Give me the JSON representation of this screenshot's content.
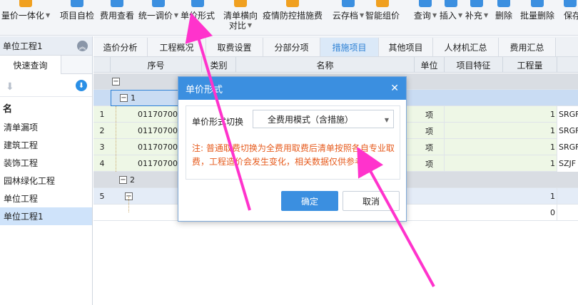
{
  "toolbar": {
    "items": [
      {
        "label": "量价一体化",
        "caret": true,
        "icon_color": "#f0a020"
      },
      {
        "label": "项目自检",
        "caret": false,
        "icon_color": "#3b8fe0"
      },
      {
        "label": "费用查看",
        "caret": false,
        "icon_color": "#3b8fe0"
      },
      {
        "label": "统一调价",
        "caret": true,
        "icon_color": "#3b8fe0"
      },
      {
        "label": "单价形式",
        "caret": false,
        "icon_color": "#3b8fe0"
      },
      {
        "label": "清单横向",
        "label2": "对比",
        "caret": true,
        "icon_color": "#f0a020"
      },
      {
        "label": "疫情防控措施费",
        "caret": false,
        "icon_color": "#f0a020"
      },
      {
        "label": "云存档",
        "caret": true,
        "icon_color": "#3b8fe0"
      },
      {
        "label": "智能组价",
        "caret": false,
        "icon_color": "#f0a020"
      },
      {
        "label": "查询",
        "caret": true,
        "icon_color": "#3b8fe0"
      },
      {
        "label": "插入",
        "caret": true,
        "icon_color": "#3b8fe0"
      },
      {
        "label": "补充",
        "caret": true,
        "icon_color": "#3b8fe0"
      },
      {
        "label": "删除",
        "caret": false,
        "icon_color": "#3b8fe0"
      },
      {
        "label": "批量删除",
        "caret": false,
        "icon_color": "#3b8fe0"
      },
      {
        "label": "保存",
        "caret": false,
        "icon_color": "#3b8fe0"
      }
    ]
  },
  "left_panel": {
    "title": "单位工程1",
    "collapse_icon": "double-chevron-up-icon",
    "tab": "快速查询",
    "section_label": "名",
    "items": [
      {
        "label": "清单漏项",
        "active": false
      },
      {
        "label": "建筑工程",
        "active": false
      },
      {
        "label": "装饰工程",
        "active": false
      },
      {
        "label": "园林绿化工程",
        "active": false
      },
      {
        "label": "单位工程",
        "active": false
      },
      {
        "label": "单位工程1",
        "active": true
      }
    ]
  },
  "tabs": [
    {
      "label": "造价分析",
      "active": false
    },
    {
      "label": "工程概况",
      "active": false
    },
    {
      "label": "取费设置",
      "active": false
    },
    {
      "label": "分部分项",
      "active": false
    },
    {
      "label": "措施项目",
      "active": true
    },
    {
      "label": "其他项目",
      "active": false
    },
    {
      "label": "人材机汇总",
      "active": false
    },
    {
      "label": "费用汇总",
      "active": false
    }
  ],
  "grid": {
    "columns": [
      "序号",
      "类别",
      "名称",
      "单位",
      "项目特征",
      "工程量"
    ],
    "rows": [
      {
        "num": "",
        "code": "",
        "type": "group0",
        "unit": "",
        "qty": "",
        "extra": ""
      },
      {
        "num": "",
        "code": "1",
        "type": "group1",
        "unit": "",
        "qty": "",
        "extra": ""
      },
      {
        "num": "1",
        "code": "01170700",
        "type": "item",
        "unit": "项",
        "qty": "1",
        "extra": "SRGF"
      },
      {
        "num": "2",
        "code": "01170700",
        "type": "item",
        "unit": "项",
        "qty": "1",
        "extra": "SRGF"
      },
      {
        "num": "3",
        "code": "01170700",
        "type": "item",
        "unit": "项",
        "qty": "1",
        "extra": "SRGF"
      },
      {
        "num": "4",
        "code": "01170700",
        "type": "item",
        "unit": "项",
        "qty": "1",
        "extra": "SZJF"
      },
      {
        "num": "",
        "code": "2",
        "type": "group2",
        "unit": "",
        "qty": "",
        "extra": ""
      },
      {
        "num": "5",
        "code": "",
        "type": "sub",
        "unit": "",
        "qty": "1",
        "extra": ""
      },
      {
        "num": "",
        "code": "",
        "type": "leaf",
        "unit": "",
        "qty": "0",
        "extra": ""
      }
    ]
  },
  "dialog": {
    "title": "单价形式",
    "close_icon": "close-icon",
    "switch_label": "单价形式切换",
    "select_value": "全费用模式（含措施）",
    "note": "注: 普通取费切换为全费用取费后清单按照各自专业取费，工程造价会发生变化，相关数据仅供参考。",
    "ok_label": "确定",
    "cancel_label": "取消"
  },
  "colors": {
    "accent": "#3b8fe0",
    "note": "#e65a1c",
    "annotation": "#ff33cc",
    "row_green": "#eef7e6",
    "row_blue": "#c9dcf3"
  }
}
